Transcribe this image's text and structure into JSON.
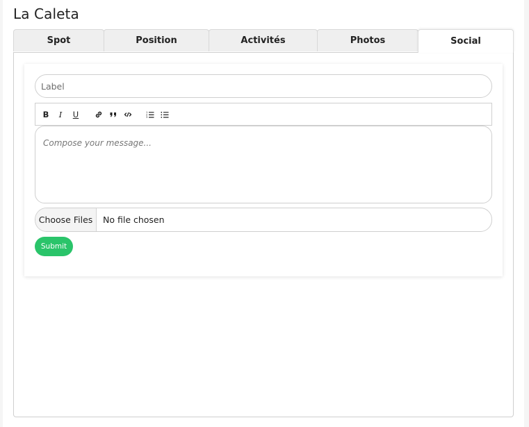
{
  "page": {
    "title": "La Caleta"
  },
  "tabs": [
    {
      "label": "Spot",
      "active": false
    },
    {
      "label": "Position",
      "active": false
    },
    {
      "label": "Activités",
      "active": false
    },
    {
      "label": "Photos",
      "active": false
    },
    {
      "label": "Social",
      "active": true
    }
  ],
  "form": {
    "label_placeholder": "Label",
    "label_value": "",
    "toolbar": {
      "bold": "B",
      "italic": "I",
      "underline": "U",
      "icons": [
        "link-icon",
        "quote-icon",
        "code-icon",
        "ordered-list-icon",
        "bullet-list-icon"
      ]
    },
    "message_placeholder": "Compose your message...",
    "file_button_label": "Choose Files",
    "file_status": "No file chosen",
    "submit_label": "Submit"
  },
  "colors": {
    "accent_green": "#2ac46a",
    "tab_inactive": "#efefef",
    "border": "#cfcfcf"
  }
}
